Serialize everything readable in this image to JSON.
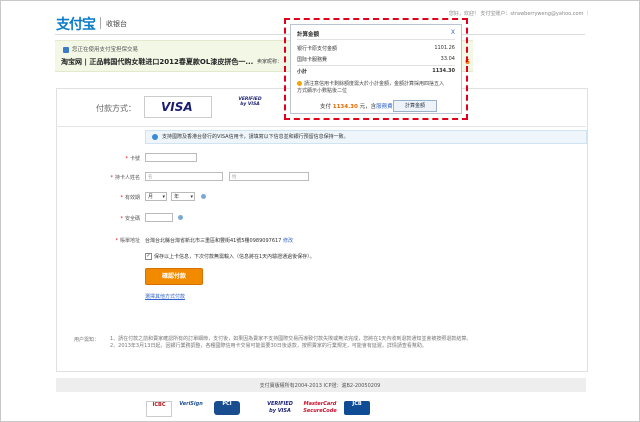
{
  "header": {
    "logo": "支付宝",
    "subtitle": "收银台",
    "userbar": "您好，欢迎！ 支付宝账户：strawberryweng@yahoo.com ｜"
  },
  "notice": {
    "line1": "您正在使用支付宝担保交易",
    "item": "淘宝网 | 正品韩国代购女鞋进口2012春夏款OL漆皮拼色一...",
    "more": "卖家昵称：",
    "amount_tail": "6"
  },
  "popup": {
    "title": "計算金額",
    "close": "X",
    "rows": [
      {
        "label": "银行卡原支付金額",
        "value": "1101.26"
      },
      {
        "label": "国际卡服務費",
        "value": "33.04"
      },
      {
        "label": "小計",
        "value": "1134.30"
      }
    ],
    "tip": "請注意信用卡剩餘額度需大於小計金額，金額計算採用四捨五入方式顯示小數點後二位",
    "pay_prefix": "支付",
    "pay_amount": "1134.30",
    "pay_unit": "元，含",
    "pay_link": "服務費",
    "calc_button": "計算金額"
  },
  "form": {
    "title": "付款方式：",
    "visa": "VISA",
    "vbv": "VERIFIED by VISA",
    "info": "支持國際及香港台發行的VISA信用卡，請填寫以下信息並和銀行預留信息保持一致。",
    "card_no_label": "卡號",
    "holder_label": "持卡人姓名",
    "holder_first_placeholder": "名",
    "holder_last_placeholder": "姓",
    "expiry_label": "有效期",
    "expiry_month": "月",
    "expiry_year": "年",
    "cvv_label": "安全碼",
    "address_label": "賬單地址",
    "address": "台灣台北縣台灣省新北市三重區和豐街41號5樓0989097617",
    "address_edit": "修改",
    "save_label": "保存以上卡信息，下次付款無需輸入（信息將在1天內驗證通過後保存）。",
    "confirm": "確認付款",
    "other": "選擇其他方式付款"
  },
  "notes": {
    "label": "用户需知：",
    "items": [
      "1、請在付款之前和賣家確認所有的訂單細節，支付後，如果因為賣家不支持國際交易而導致付款失敗或無法完成，您將在1天內收到退款通知並會被按照退款結算。",
      "2、2013年3月13日起，因銀行業務調整，各種國際信用卡交易可能需要30日後退款，按照賣家的行業規定，可能會有延遲，詳情請查看幫助。"
    ]
  },
  "footer": {
    "copyright": "支付寶版權所有2004-2013 ICP證：滬B2-20050209",
    "badges": [
      "ICBC",
      "VeriSign",
      "PCI",
      "VERIFIED by VISA",
      "MasterCard SecureCode",
      "JCB"
    ]
  }
}
